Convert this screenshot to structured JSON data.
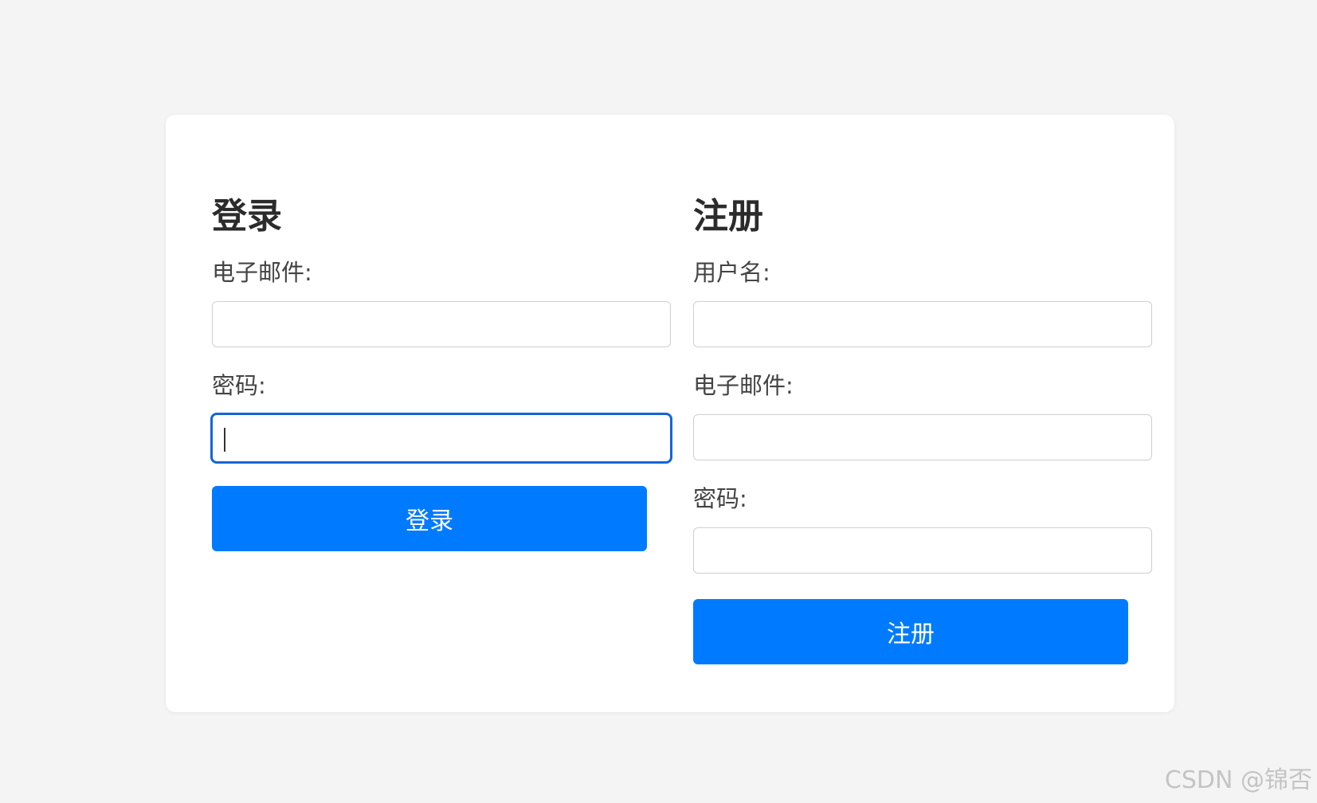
{
  "login": {
    "title": "登录",
    "email_label": "电子邮件:",
    "email_value": "",
    "password_label": "密码:",
    "password_value": "",
    "submit_label": "登录"
  },
  "register": {
    "title": "注册",
    "username_label": "用户名:",
    "username_value": "",
    "email_label": "电子邮件:",
    "email_value": "",
    "password_label": "密码:",
    "password_value": "",
    "submit_label": "注册"
  },
  "watermark": "CSDN @锦否",
  "colors": {
    "accent": "#007bff",
    "focus_border": "#1565d8",
    "background": "#f4f4f4"
  }
}
